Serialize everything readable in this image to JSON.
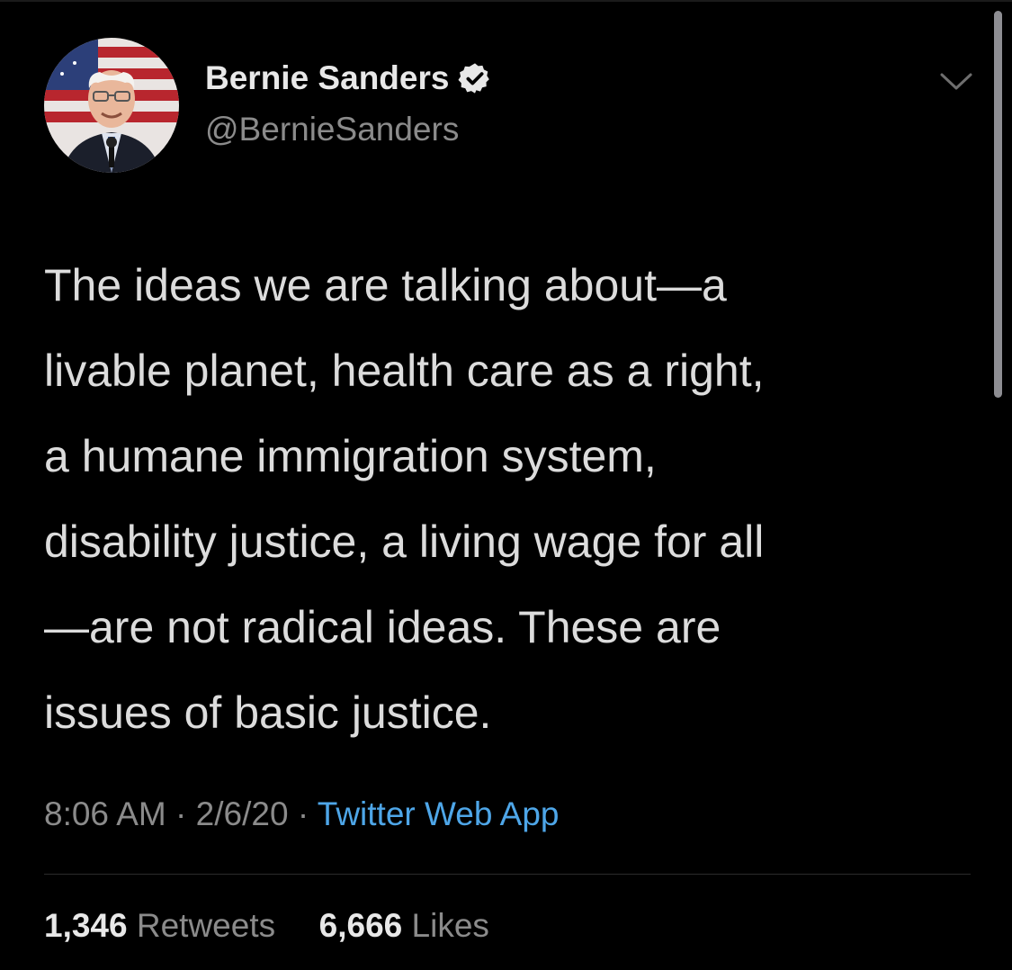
{
  "tweet": {
    "author": {
      "display_name": "Bernie Sanders",
      "handle": "@BernieSanders",
      "verified": true,
      "avatar_icon": "profile-photo"
    },
    "text_lines": [
      "The ideas we are talking about—a",
      "livable planet, health care as a right,",
      "a humane immigration system,",
      "disability justice, a living wage for all",
      "—are not radical ideas. These are",
      "issues of basic justice."
    ],
    "time": "8:06 AM",
    "separator": "·",
    "date": "2/6/20",
    "source": "Twitter Web App",
    "retweets_count": "1,346",
    "retweets_label": "Retweets",
    "likes_count": "6,666",
    "likes_label": "Likes"
  },
  "colors": {
    "background": "#000000",
    "text": "#dcdcdc",
    "muted": "#8b8b8b",
    "link": "#4ea6e8"
  },
  "icons": {
    "verified": "verified-badge-icon",
    "more": "chevron-down-icon"
  }
}
